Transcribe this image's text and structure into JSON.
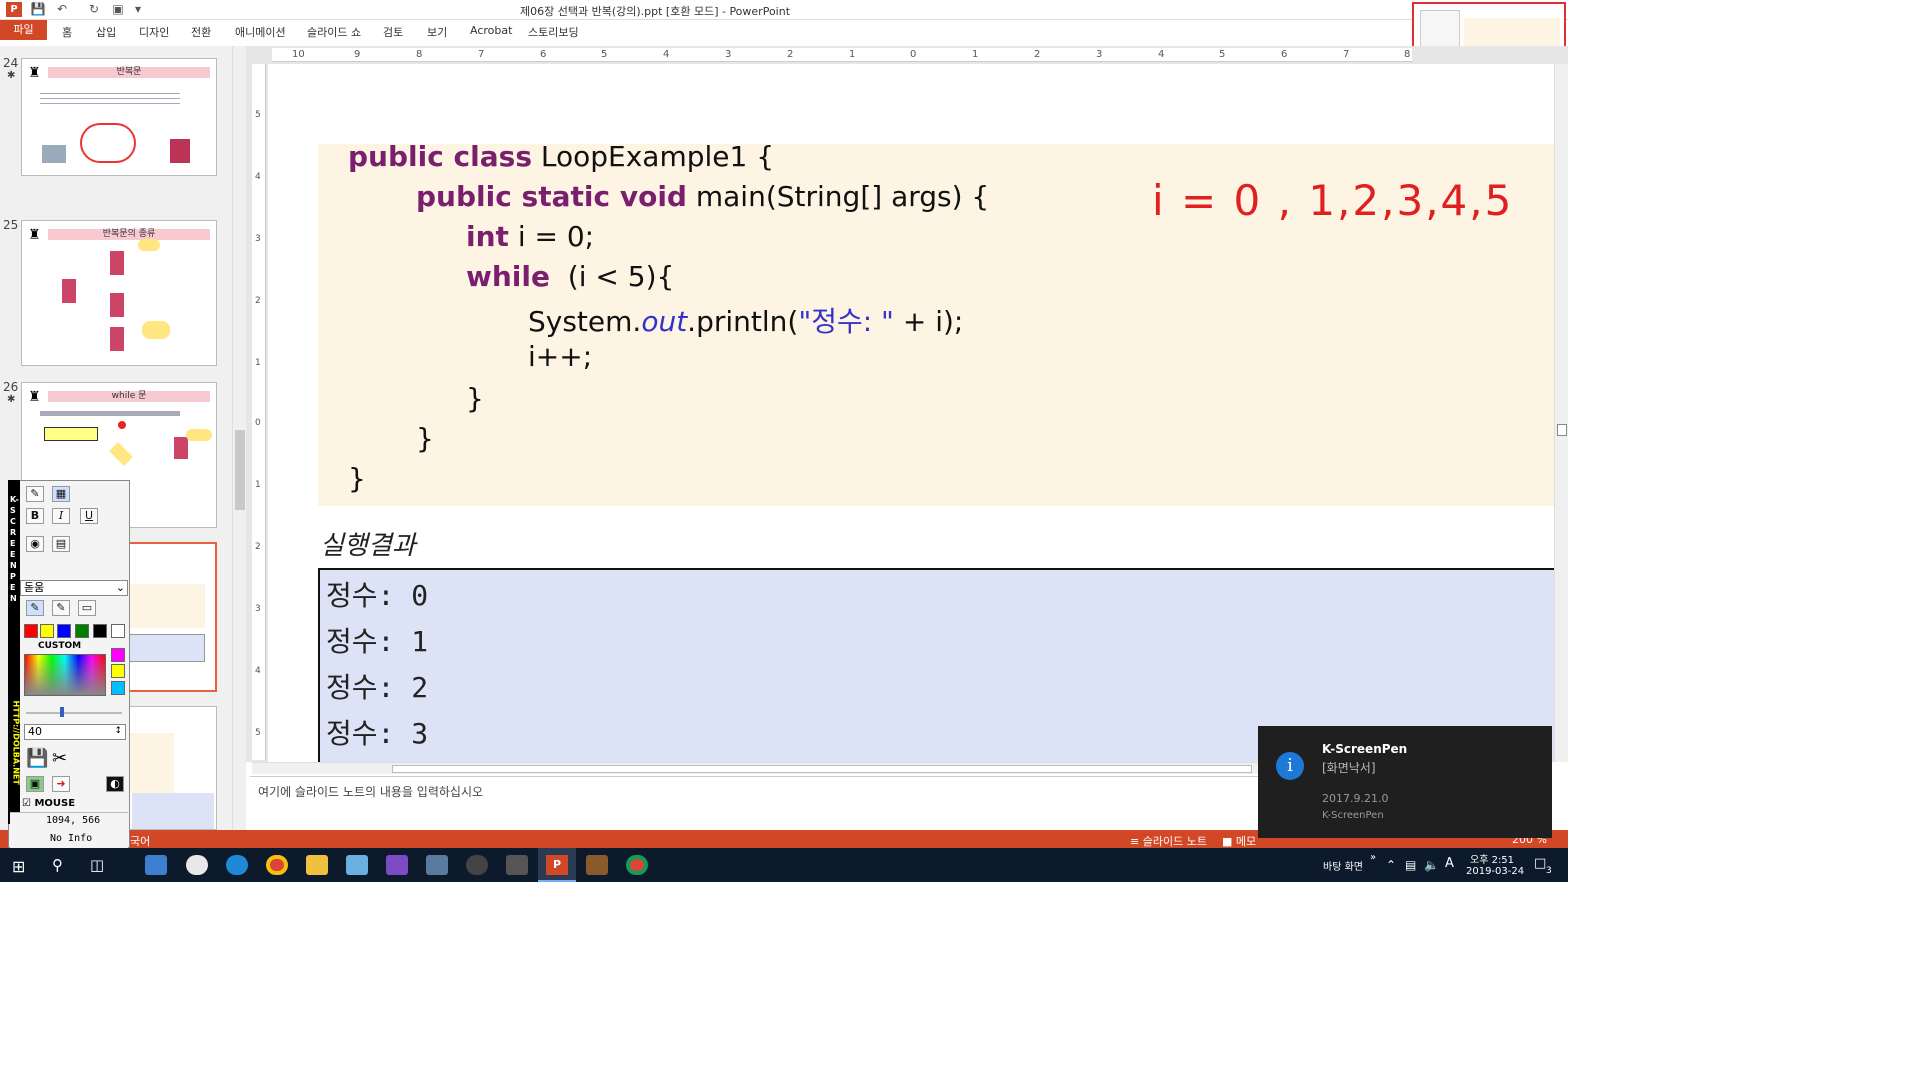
{
  "window": {
    "title": "제06장 선택과 반복(강의).ppt [호환 모드] - PowerPoint"
  },
  "ribbon": {
    "file_tab": "파일",
    "tabs": [
      "홈",
      "삽입",
      "디자인",
      "전환",
      "애니메이션",
      "슬라이드 쇼",
      "검토",
      "보기",
      "Acrobat",
      "스토리보딩"
    ]
  },
  "thumbnails": [
    {
      "num": "24",
      "title": "반복문"
    },
    {
      "num": "25",
      "title": "반복문의 종류"
    },
    {
      "num": "26",
      "title": "while 문"
    }
  ],
  "ruler": {
    "h_labels": [
      "10",
      "9",
      "8",
      "7",
      "6",
      "5",
      "4",
      "3",
      "2",
      "1",
      "0",
      "1",
      "2",
      "3",
      "4",
      "5",
      "6",
      "7",
      "8"
    ],
    "v_labels": [
      "5",
      "4",
      "3",
      "2",
      "1",
      "0",
      "1",
      "2",
      "3",
      "4",
      "5"
    ]
  },
  "slide": {
    "code_lines": [
      {
        "indent": 0,
        "kw": "public class",
        "rest": " LoopExample1 {"
      },
      {
        "indent": 1,
        "kw": "public static void",
        "rest": " main(String[] args) {"
      },
      {
        "indent": 2,
        "kw": "int",
        "rest": " i = 0;"
      },
      {
        "indent": 2,
        "kw": "while",
        "rest": "  (i < 5){"
      },
      {
        "indent": 3,
        "kw": "",
        "rest": "System.out.println(\"정수: \" + i);"
      },
      {
        "indent": 3,
        "kw": "",
        "rest": "i++;"
      },
      {
        "indent": 2,
        "kw": "",
        "rest": "}"
      },
      {
        "indent": 1,
        "kw": "",
        "rest": "}"
      },
      {
        "indent": 0,
        "kw": "",
        "rest": "}"
      }
    ],
    "code_line4_prefix": "System.",
    "code_line4_italic": "out",
    "code_line4_mid": ".println(",
    "code_line4_string": "\"정수: \"",
    "code_line4_tail": " + i);",
    "annotation": "i = 0 , 1,2,3,4,5",
    "result_title": "실행결과",
    "results": [
      "정수: 0",
      "정수: 1",
      "정수: 2",
      "정수: 3"
    ]
  },
  "notes": {
    "placeholder": "여기에 슬라이드 노트의 내용을 입력하십시오"
  },
  "statusbar": {
    "left_text": "국어",
    "notes_btn": "슬라이드 노트",
    "memo_btn": "메모",
    "zoom": "200 %"
  },
  "kpen": {
    "side_text": "K-SCREEN PEN",
    "url_text": "HTTP://DOLBA.NET",
    "bold": "B",
    "italic": "I",
    "underline": "U",
    "font": "돋움",
    "custom_label": "CUSTOM",
    "size": "40",
    "mouse_label": "MOUSE",
    "coords": "1094, 566",
    "info": "No Info",
    "colors": [
      "#ff0000",
      "#ffff00",
      "#0000ff",
      "#008000",
      "#000000",
      "#ffffff"
    ],
    "extra_colors": [
      "#ff00ff",
      "#ffff00",
      "#00c0ff"
    ]
  },
  "toast": {
    "app": "K-ScreenPen",
    "subtitle": "[화면낙서]",
    "version": "2017.9.21.0",
    "source": "K-ScreenPen"
  },
  "taskbar": {
    "desktop_label": "바탕 화면",
    "time": "오후 2:51",
    "date": "2019-03-24",
    "notif_count": "3",
    "ime": "A"
  }
}
